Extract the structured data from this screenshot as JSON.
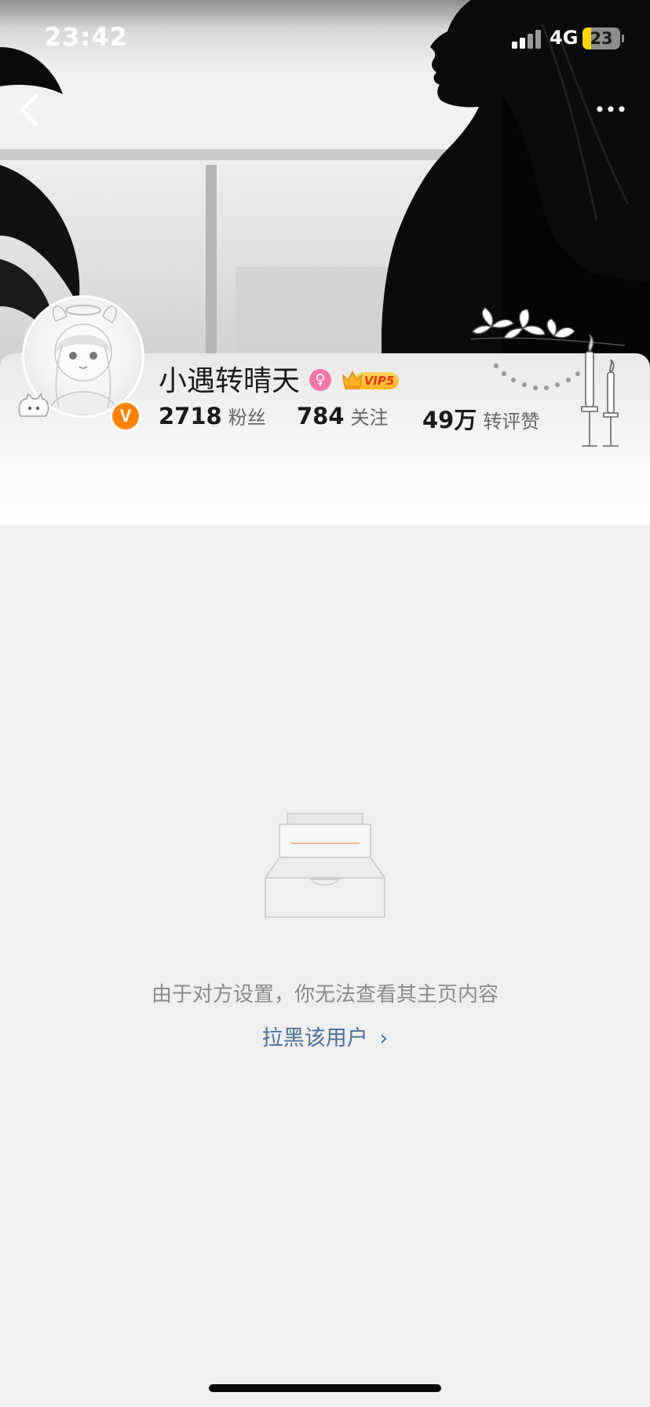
{
  "status_bar": {
    "time": "23:42",
    "network": "4G",
    "battery_level": "23",
    "battery_fraction": 0.23,
    "signal_bars_active": 2,
    "signal_bars_total": 4
  },
  "nav": {
    "back_icon": "chevron-left-icon",
    "more_icon": "ellipsis-icon"
  },
  "profile": {
    "username": "小遇转晴天",
    "gender_symbol": "♀",
    "vip_label": "VIP5",
    "verified_label": "V",
    "stats": [
      {
        "value": "2718",
        "label": "粉丝"
      },
      {
        "value": "784",
        "label": "关注"
      },
      {
        "value": "49万",
        "label": "转评赞"
      }
    ]
  },
  "empty_state": {
    "icon": "empty-inbox-icon",
    "message": "由于对方设置，你无法查看其主页内容",
    "action_label": "拉黑该用户",
    "action_arrow": "›"
  },
  "colors": {
    "accent_link": "#4e6f96",
    "verified": "#ff8200",
    "gender": "#f277a4",
    "battery": "#ffd60a",
    "background": "#efefef"
  }
}
